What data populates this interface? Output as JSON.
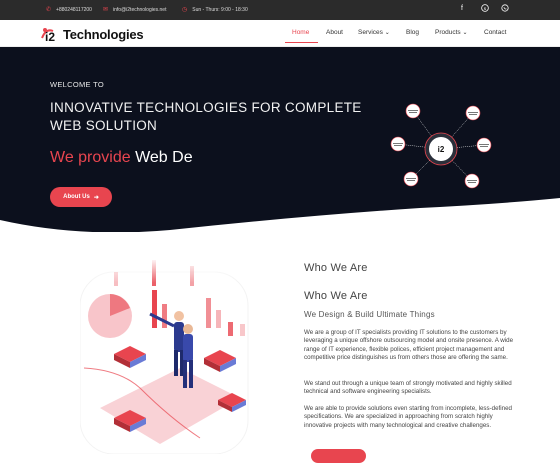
{
  "topbar": {
    "phone": "+880248117200",
    "email": "info@i2technologies.net",
    "hours": "Sun - Thurs: 9:00 - 18:30",
    "social": [
      {
        "icon": "facebook-icon"
      },
      {
        "icon": "skype-icon"
      },
      {
        "icon": "whatsapp-icon"
      }
    ]
  },
  "brand": {
    "logo_text": "Technologies",
    "logo_mark": "i2"
  },
  "nav": {
    "items": [
      {
        "label": "Home",
        "active": true
      },
      {
        "label": "About"
      },
      {
        "label": "Services",
        "dropdown": true
      },
      {
        "label": "Blog"
      },
      {
        "label": "Products",
        "dropdown": true
      },
      {
        "label": "Contact"
      }
    ]
  },
  "hero": {
    "welcome": "WELCOME TO",
    "headline": "INNOVATIVE TECHNOLOGIES FOR COMPLETE WEB SOLUTION",
    "typed_prefix": "We provide ",
    "typed_text": "Web De",
    "button_label": "About Us",
    "diagram_center": "i2"
  },
  "who": {
    "heading_1": "Who We Are",
    "heading_2": "Who We Are",
    "tagline": "We Design & Build Ultimate Things",
    "paragraphs": [
      "We are a group of IT specialists providing IT solutions to the customers by leveraging a unique offshore outsourcing model and onsite presence. A wide range of IT experience, flexible polices, efficient project management and competitive price distinguishes us from others those are offering the same.",
      "We stand out through a unique team of strongly motivated and highly skilled technical and software engineering specialists.",
      "We are able to provide solutions even starting from incomplete, less-defined specifications. We are specialized in approaching from scratch highly innovative projects with many technological and creative challenges."
    ]
  },
  "colors": {
    "accent": "#e8454f",
    "hero_bg": "#0c101d",
    "topbar_bg": "#2b2b2b"
  }
}
